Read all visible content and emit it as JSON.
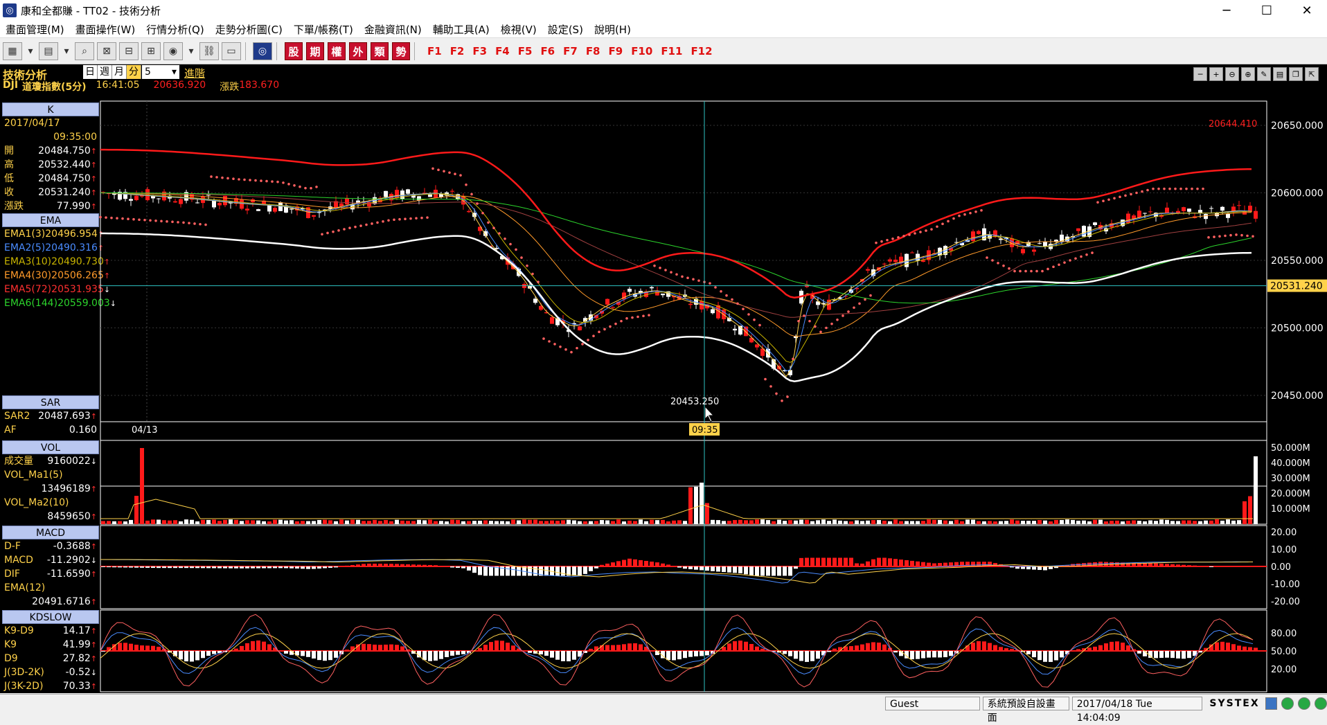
{
  "window": {
    "title": "康和全都賺 - TT02 - 技術分析",
    "controls": {
      "minimize": "─",
      "maximize": "☐",
      "close": "✕"
    }
  },
  "menu": [
    "畫面管理(M)",
    "畫面操作(W)",
    "行情分析(Q)",
    "走勢分析圖(C)",
    "下單/帳務(T)",
    "金融資訊(N)",
    "輔助工具(A)",
    "檢視(V)",
    "設定(S)",
    "說明(H)"
  ],
  "toolbar": {
    "categories": [
      "股",
      "期",
      "權",
      "外",
      "類",
      "勢"
    ],
    "fkeys": [
      "F1",
      "F2",
      "F3",
      "F4",
      "F5",
      "F6",
      "F7",
      "F8",
      "F9",
      "F10",
      "F11",
      "F12"
    ]
  },
  "header": {
    "title": "技術分析",
    "period_tabs": [
      "日",
      "週",
      "月",
      "分"
    ],
    "active_tab": "分",
    "period_value": "5",
    "advanced": "進階",
    "symbol": "DJI",
    "name": "道瓊指數(5分)",
    "time": "16:41:05",
    "price": "20636.920",
    "change_label": "漲跌",
    "change": "183.670"
  },
  "k_panel": {
    "head": "K",
    "date": "2017/04/17",
    "time": "09:35:00",
    "rows": [
      {
        "label": "開",
        "value": "20484.750",
        "arrow": "↑"
      },
      {
        "label": "高",
        "value": "20532.440",
        "arrow": "↑"
      },
      {
        "label": "低",
        "value": "20484.750",
        "arrow": "↑"
      },
      {
        "label": "收",
        "value": "20531.240",
        "arrow": "↑"
      },
      {
        "label": "漲跌",
        "value": "77.990",
        "arrow": "↑"
      }
    ]
  },
  "ema_panel": {
    "head": "EMA",
    "rows": [
      {
        "label": "EMA1(3)",
        "value": "20496.954",
        "arrow": "↑",
        "color": "#ffd24a"
      },
      {
        "label": "EMA2(5)",
        "value": "20490.316",
        "arrow": "↑",
        "color": "#4a8cff"
      },
      {
        "label": "EMA3(10)",
        "value": "20490.730",
        "arrow": "↑",
        "color": "#c8b400"
      },
      {
        "label": "EMA4(30)",
        "value": "20506.265",
        "arrow": "↑",
        "color": "#ff9a2a"
      },
      {
        "label": "EMA5(72)",
        "value": "20531.935",
        "arrow": "↓",
        "color": "#ff3030"
      },
      {
        "label": "EMA6(144)",
        "value": "20559.003",
        "arrow": "↓",
        "color": "#2cd42c"
      }
    ]
  },
  "sar_panel": {
    "head": "SAR",
    "rows": [
      {
        "label": "SAR2",
        "value": "20487.693",
        "arrow": "↑"
      },
      {
        "label": "AF",
        "value": "0.160",
        "arrow": ""
      }
    ]
  },
  "vol_panel": {
    "head": "VOL",
    "rows": [
      {
        "label": "成交量",
        "value": "9160022",
        "arrow": "↓"
      },
      {
        "label": "VOL_Ma1(5)",
        "value": "",
        "arrow": ""
      },
      {
        "label": "",
        "value": "13496189",
        "arrow": "↑"
      },
      {
        "label": "VOL_Ma2(10)",
        "value": "",
        "arrow": ""
      },
      {
        "label": "",
        "value": "8459650",
        "arrow": "↑"
      }
    ]
  },
  "macd_panel": {
    "head": "MACD",
    "rows": [
      {
        "label": "D-F",
        "value": "-0.3688",
        "arrow": "↑"
      },
      {
        "label": "MACD",
        "value": "-11.2902",
        "arrow": "↓"
      },
      {
        "label": "DIF",
        "value": "-11.6590",
        "arrow": "↑"
      },
      {
        "label": "EMA(12)",
        "value": "",
        "arrow": ""
      },
      {
        "label": "",
        "value": "20491.6716",
        "arrow": "↑"
      }
    ]
  },
  "kd_panel": {
    "head": "KDSLOW",
    "rows": [
      {
        "label": "K9-D9",
        "value": "14.17",
        "arrow": "↑"
      },
      {
        "label": "K9",
        "value": "41.99",
        "arrow": "↑"
      },
      {
        "label": "D9",
        "value": "27.82",
        "arrow": "↑"
      },
      {
        "label": "J(3D-2K)",
        "value": "-0.52",
        "arrow": "↓"
      },
      {
        "label": "J(3K-2D)",
        "value": "70.33",
        "arrow": "↑"
      }
    ]
  },
  "price_axis": {
    "ticks": [
      "20650.000",
      "20600.000",
      "20550.000",
      "20500.000",
      "20450.000"
    ],
    "tick_values": [
      20650,
      20600,
      20550,
      20500,
      20450
    ],
    "current": "20531.240",
    "current_value": 20531.24,
    "high_label": "20644.410",
    "low_label": "20453.250",
    "high": 20644.41,
    "low": 20453.25,
    "crosshair_time": "09:35",
    "date_mark": "04/13"
  },
  "vol_axis": [
    "50.000M",
    "40.000M",
    "30.000M",
    "20.000M",
    "10.000M"
  ],
  "macd_axis": [
    "20.00",
    "10.00",
    "0.00",
    "-10.00",
    "-20.00"
  ],
  "kd_axis": [
    "80.00",
    "50.00",
    "20.00"
  ],
  "status": {
    "user": "Guest",
    "layout": "系統預設自設畫面",
    "datetime": "2017/04/18 Tue 14:04:09",
    "brand": "SYSTEX"
  },
  "colors": {
    "up": "#ff1a1a",
    "down": "#ffffff",
    "axis_text": "#ffffff",
    "header": "#ffd24a",
    "label_yellow": "#ffd24a"
  }
}
